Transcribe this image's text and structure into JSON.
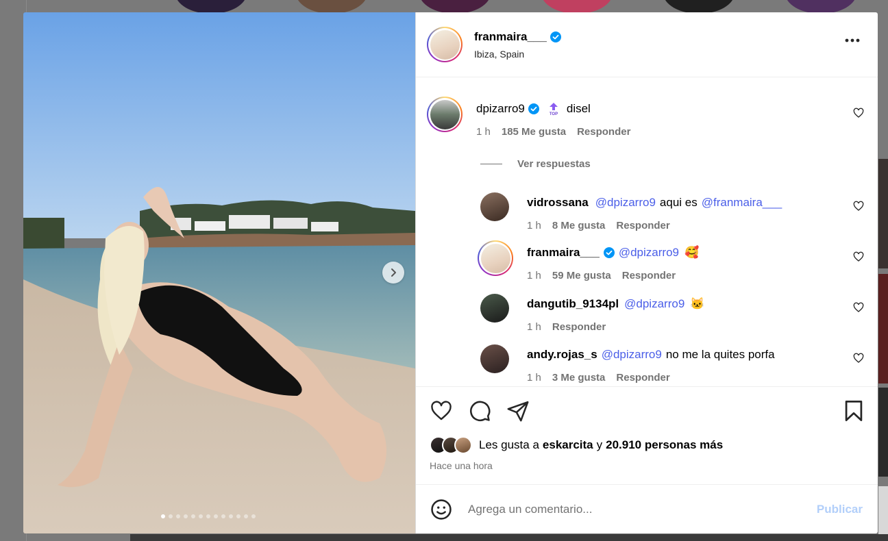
{
  "post": {
    "author": "franmaira___",
    "location": "Ibiza, Spain",
    "verified": true,
    "carousel_total": 13,
    "carousel_current": 1
  },
  "comments": [
    {
      "user": "dpizarro9",
      "verified": true,
      "badge_icon": "top-fan-badge-icon",
      "text": "disel",
      "time": "1 h",
      "likes": "185 Me gusta",
      "reply": "Responder"
    },
    {
      "user": "vidrossana",
      "mention": "@dpizarro9",
      "text": "aqui es",
      "mention2": "@franmaira___",
      "time": "1 h",
      "likes": "8 Me gusta",
      "reply": "Responder"
    },
    {
      "user": "franmaira___",
      "verified": true,
      "mention": "@dpizarro9",
      "emoji": "🥰",
      "time": "1 h",
      "likes": "59 Me gusta",
      "reply": "Responder"
    },
    {
      "user": "dangutib_9134pl",
      "mention": "@dpizarro9",
      "emoji": "🐱",
      "time": "1 h",
      "reply": "Responder"
    },
    {
      "user": "andy.rojas_s",
      "mention": "@dpizarro9",
      "text": "no me la quites porfa",
      "time": "1 h",
      "likes": "3 Me gusta",
      "reply": "Responder"
    }
  ],
  "view_replies": "Ver respuestas",
  "likes_line": {
    "prefix": "Les gusta a",
    "user": "eskarcita",
    "joiner": "y",
    "others": "20.910 personas más"
  },
  "posted_time": "Hace una hora",
  "composer": {
    "placeholder": "Agrega un comentario...",
    "publish": "Publicar"
  },
  "colors": {
    "link": "#4a5ee8",
    "verified": "#0095f6",
    "publish_disabled": "#b2cffa"
  }
}
